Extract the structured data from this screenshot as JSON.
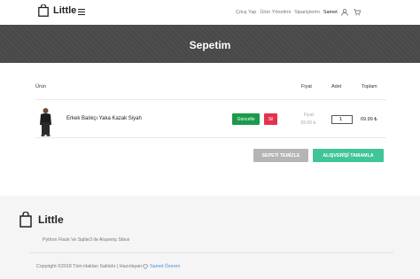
{
  "header": {
    "brand": "Little",
    "nav": [
      "Çıkış Yap",
      "Ürün Yönetimi",
      "Siparişlerim"
    ],
    "user": "Samet"
  },
  "banner": {
    "title": "Sepetim"
  },
  "table": {
    "headers": {
      "product": "Ürün",
      "price": "Fiyat",
      "qty": "Adet",
      "total": "Toplam"
    },
    "rows": [
      {
        "name": "Erkek Balıkçı Yaka Kazak Siyah",
        "update_label": "Güncelle",
        "delete_label": "Sil",
        "price_label": "Fiyat:",
        "price": "69.99 ₺",
        "qty": "1",
        "total": "69.99 ₺"
      }
    ]
  },
  "actions": {
    "clear": "SEPETİ TEMİZLE",
    "complete": "ALIŞVERİŞİ TAMAMLA"
  },
  "footer": {
    "brand": "Little",
    "description": "Python Flask Ve Sqlite3 ile Alışveriş Sitesi",
    "copyright_prefix": "Copyright ©2018 Tüm Hakları Saklıdır | Hazırlayan",
    "author": "Samet Özeren"
  },
  "colors": {
    "banner": "#484848",
    "update": "#1a9b4a",
    "delete": "#e2344d",
    "clear": "#b5b5b5",
    "complete": "#40c49a",
    "link": "#4a90d9"
  }
}
